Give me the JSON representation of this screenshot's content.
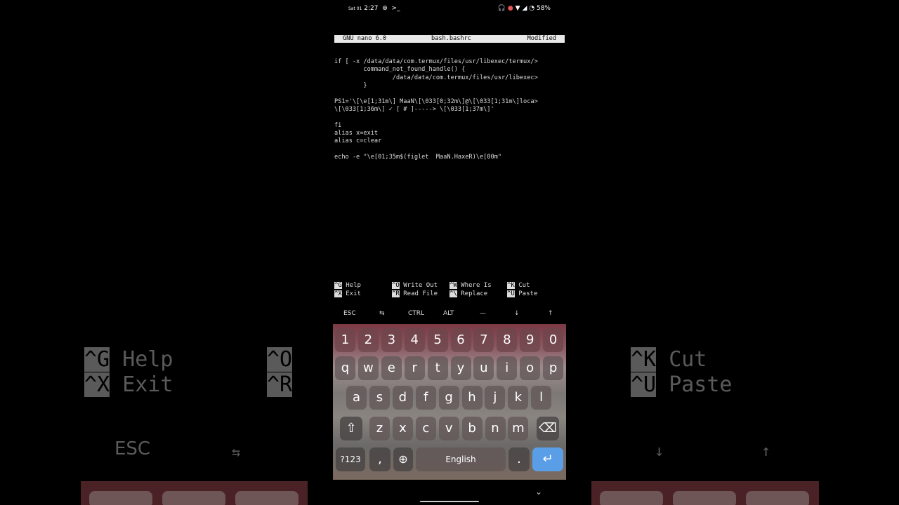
{
  "status_bar": {
    "date": "Sat 01",
    "time": "2:27",
    "battery": "58%",
    "terminal_glyph": ">_"
  },
  "nano": {
    "version": "GNU nano 6.0",
    "filename": "bash.bashrc",
    "state": "Modified",
    "lines": [
      "if [ -x /data/data/com.termux/files/usr/libexec/termux/>",
      "        command_not_found_handle() {",
      "                /data/data/com.termux/files/usr/libexec>",
      "        }",
      "",
      "PS1='\\[\\e[1;31m\\] MaaN\\[\\033[0;32m\\]@\\[\\033[1;31m\\]loca>",
      "\\[\\033[1;36m\\] ✓ [ # ]-----> \\[\\033[1;37m\\]'",
      "",
      "fi",
      "alias x=exit",
      "alias c=clear",
      "",
      "echo -e \"\\e[01;35m$(figlet  MaaN.HaxeR)\\e[00m\""
    ]
  },
  "shortcuts": [
    {
      "key": "^G",
      "label": "Help"
    },
    {
      "key": "^X",
      "label": "Exit"
    },
    {
      "key": "^O",
      "label": "Write Out"
    },
    {
      "key": "^R",
      "label": "Read File"
    },
    {
      "key": "^W",
      "label": "Where Is"
    },
    {
      "key": "^\\",
      "label": "Replace"
    },
    {
      "key": "^K",
      "label": "Cut"
    },
    {
      "key": "^U",
      "label": "Paste"
    }
  ],
  "extra_keys": [
    "ESC",
    "⇆",
    "CTRL",
    "ALT",
    "—",
    "↓",
    "↑"
  ],
  "keyboard": {
    "numbers": [
      "1",
      "2",
      "3",
      "4",
      "5",
      "6",
      "7",
      "8",
      "9",
      "0"
    ],
    "row1": [
      "q",
      "w",
      "e",
      "r",
      "t",
      "y",
      "u",
      "i",
      "o",
      "p"
    ],
    "row2": [
      "a",
      "s",
      "d",
      "f",
      "g",
      "h",
      "j",
      "k",
      "l"
    ],
    "row3": [
      "z",
      "x",
      "c",
      "v",
      "b",
      "n",
      "m"
    ],
    "symbols_label": "?123",
    "comma": ",",
    "space_label": "English",
    "period": ".",
    "enter_icon": "↵",
    "shift_icon": "⇧",
    "backspace_icon": "⌫",
    "globe_icon": "🌐"
  },
  "background": {
    "left": {
      "k1": "^G",
      "l1": "Help",
      "k2": "^X",
      "l2": "Exit",
      "k3": "^O",
      "k4": "^R",
      "esc": "ESC",
      "tab": "⇆"
    },
    "right": {
      "k1": "^K",
      "l1": "Cut",
      "k2": "^U",
      "l2": "Paste",
      "down": "↓",
      "up": "↑"
    }
  }
}
